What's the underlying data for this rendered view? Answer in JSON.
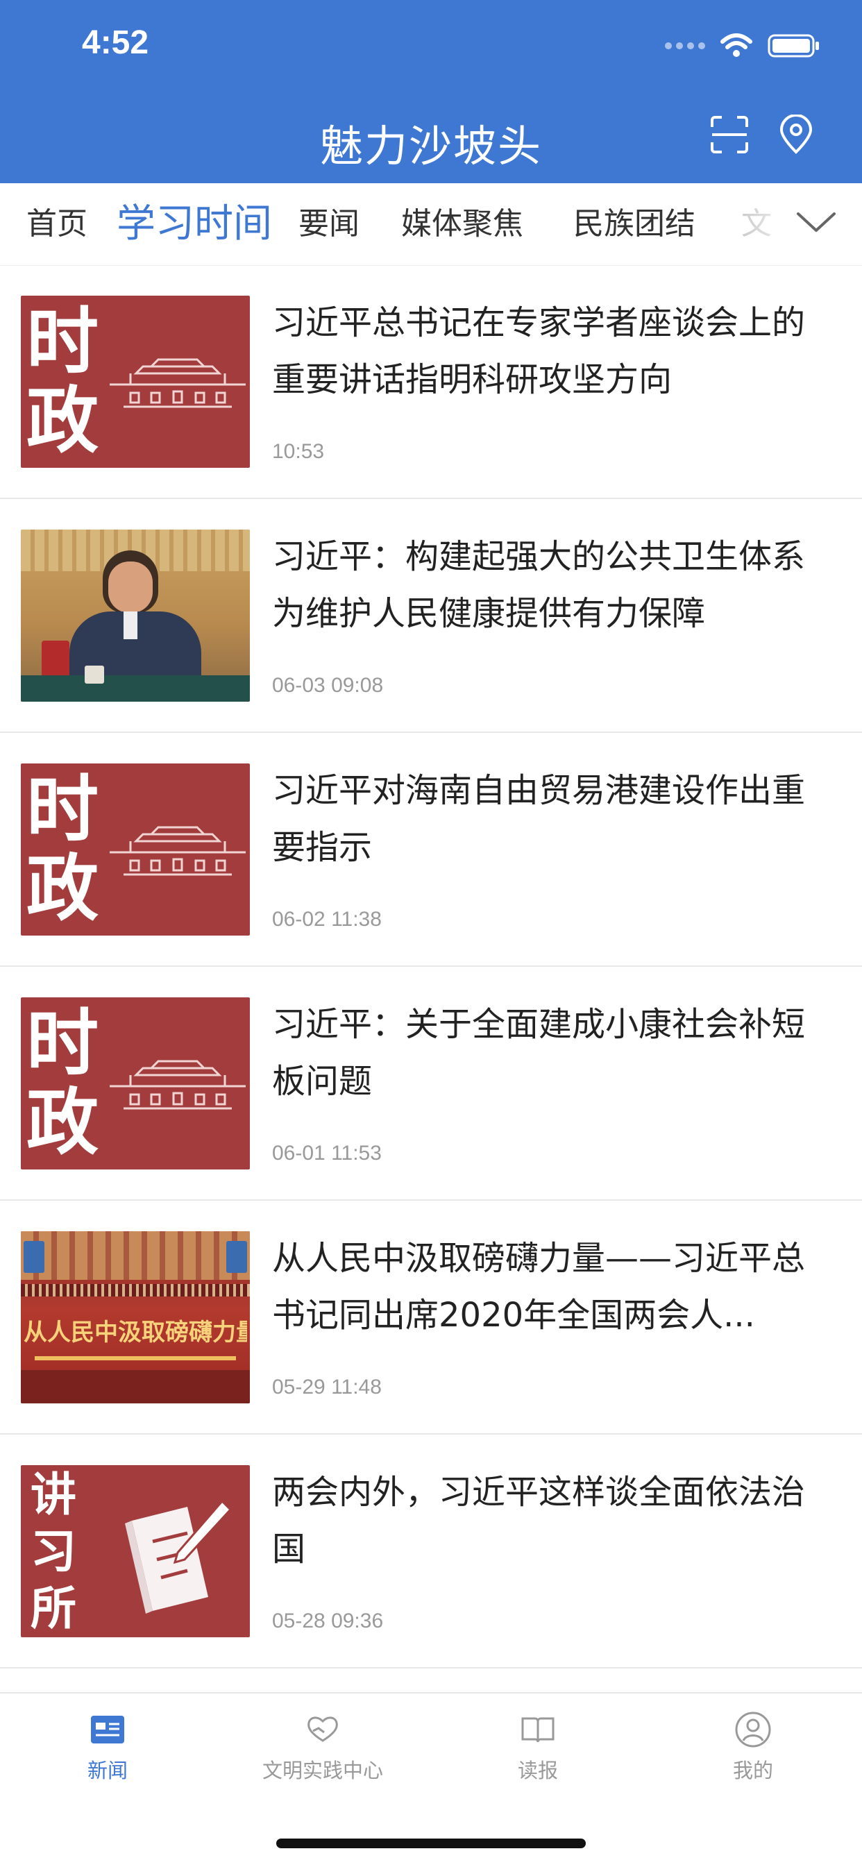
{
  "status": {
    "time": "4:52"
  },
  "header": {
    "title": "魅力沙坡头"
  },
  "tabs": [
    {
      "label": "首页",
      "active": false
    },
    {
      "label": "学习时间",
      "active": true
    },
    {
      "label": "要闻",
      "active": false
    },
    {
      "label": "媒体聚焦",
      "active": false
    },
    {
      "label": "民族团结",
      "active": false
    },
    {
      "label": "文明",
      "active": false
    }
  ],
  "thumb_text": {
    "shi": "时",
    "zheng": "政",
    "jiang": "讲",
    "xi": "习",
    "suo": "所",
    "banner": "从人民中汲取磅礴力量"
  },
  "news": [
    {
      "title": "习近平总书记在专家学者座谈会上的重要讲话指明科研攻坚方向",
      "time": "10:53",
      "thumb": "shizheng"
    },
    {
      "title": "习近平：构建起强大的公共卫生体系 为维护人民健康提供有力保障",
      "time": "06-03 09:08",
      "thumb": "photo-meeting"
    },
    {
      "title": "习近平对海南自由贸易港建设作出重要指示",
      "time": "06-02 11:38",
      "thumb": "shizheng"
    },
    {
      "title": "习近平：关于全面建成小康社会补短板问题",
      "time": "06-01 11:53",
      "thumb": "shizheng"
    },
    {
      "title": "从人民中汲取磅礴力量——习近平总书记同出席2020年全国两会人...",
      "time": "05-29 11:48",
      "thumb": "photo-hall"
    },
    {
      "title": "两会内外，习近平这样谈全面依法治国",
      "time": "05-28 09:36",
      "thumb": "jiangxisuo"
    }
  ],
  "bottom_nav": [
    {
      "label": "新闻",
      "icon": "news-icon",
      "active": true
    },
    {
      "label": "文明实践中心",
      "icon": "heart-hands-icon",
      "active": false
    },
    {
      "label": "读报",
      "icon": "book-icon",
      "active": false
    },
    {
      "label": "我的",
      "icon": "user-icon",
      "active": false
    }
  ],
  "colors": {
    "brand": "#3f78d3",
    "thumb_red": "#a33c3c",
    "muted": "#999999"
  }
}
